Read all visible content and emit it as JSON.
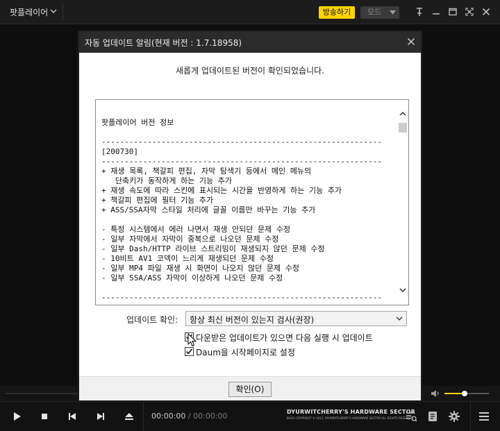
{
  "app": {
    "title": "팟플레이어",
    "broadcast_label": "방송하기",
    "mode_label": "모드"
  },
  "dialog": {
    "title": "자동 업데이트 알림(현재 버전 : 1.7.18958)",
    "message": "새롭게 업데이트된 버전이 확인되었습니다.",
    "release_notes": [
      "팟플레이어 버전 정보",
      "",
      "-------------------------------------------------------------",
      "[200730]",
      "-------------------------------------------------------------",
      "+ 재생 목록, 책갈피 편집, 자막 탐색기 등에서 메인 메뉴의",
      "   단축키가 동작하게 하는 기능 추가",
      "+ 재생 속도에 따라 스킨에 표시되는 시간을 반영하게 하는 기능 추가",
      "+ 책갈피 편집에 필터 기능 추가",
      "+ ASS/SSA자막 스타일 처리에 글꼴 이름만 바꾸는 기능 추가",
      "",
      "- 특정 시스템에서 에러 나면서 재생 안되던 문제 수정",
      "- 일부 자막에서 자막이 중복으로 나오던 문제 수정",
      "- 일부 Dash/HTTP 라이브 스트리밍이 재생되지 않던 문제 수정",
      "- 10비트 AV1 코덱이 느리게 재생되던 문제 수정",
      "- 일부 MP4 파일 재생 시 화면이 나오지 않던 문제 수정",
      "- 일부 SSA/ASS 자막이 이상하게 나오던 문제 수정",
      "",
      "-------------------------------------------------------------"
    ],
    "update_check_label": "업데이트 확인:",
    "update_check_value": "항상 최신 버전이 있는지 검사(권장)",
    "checkbox_auto_update": {
      "label": "다운받은 업데이트가 있으면 다음 실행 시 업데이트",
      "checked": true
    },
    "checkbox_daum_home": {
      "label": "Daum을 시작페이지로 설정",
      "checked": true
    },
    "ok_label": "확인(O)"
  },
  "player": {
    "current_time": "00:00:00",
    "separator": "/",
    "duration": "00:00:00",
    "volume": 0.45,
    "brand_name": "DYURWITCHERRY'S HARDWARE SECTOR",
    "brand_sub": "BLOG COPYRIGHT © 2013. DYURWITCHERRY'S HARDWARE SECTOR ALL RIGHTS RESERVED."
  },
  "colors": {
    "accent": "#ffd400",
    "dialog_titlebar": "#2b2b2b",
    "player_bg": "#0e0e0e"
  },
  "icons": [
    "chevron-down-icon",
    "pin-icon",
    "minimize-icon",
    "maximize-icon",
    "fullscreen-icon",
    "close-icon",
    "volume-icon",
    "play-icon",
    "stop-icon",
    "previous-icon",
    "next-icon",
    "eject-icon",
    "playlist-icon",
    "chapter-icon",
    "settings-icon",
    "menu-icon"
  ]
}
